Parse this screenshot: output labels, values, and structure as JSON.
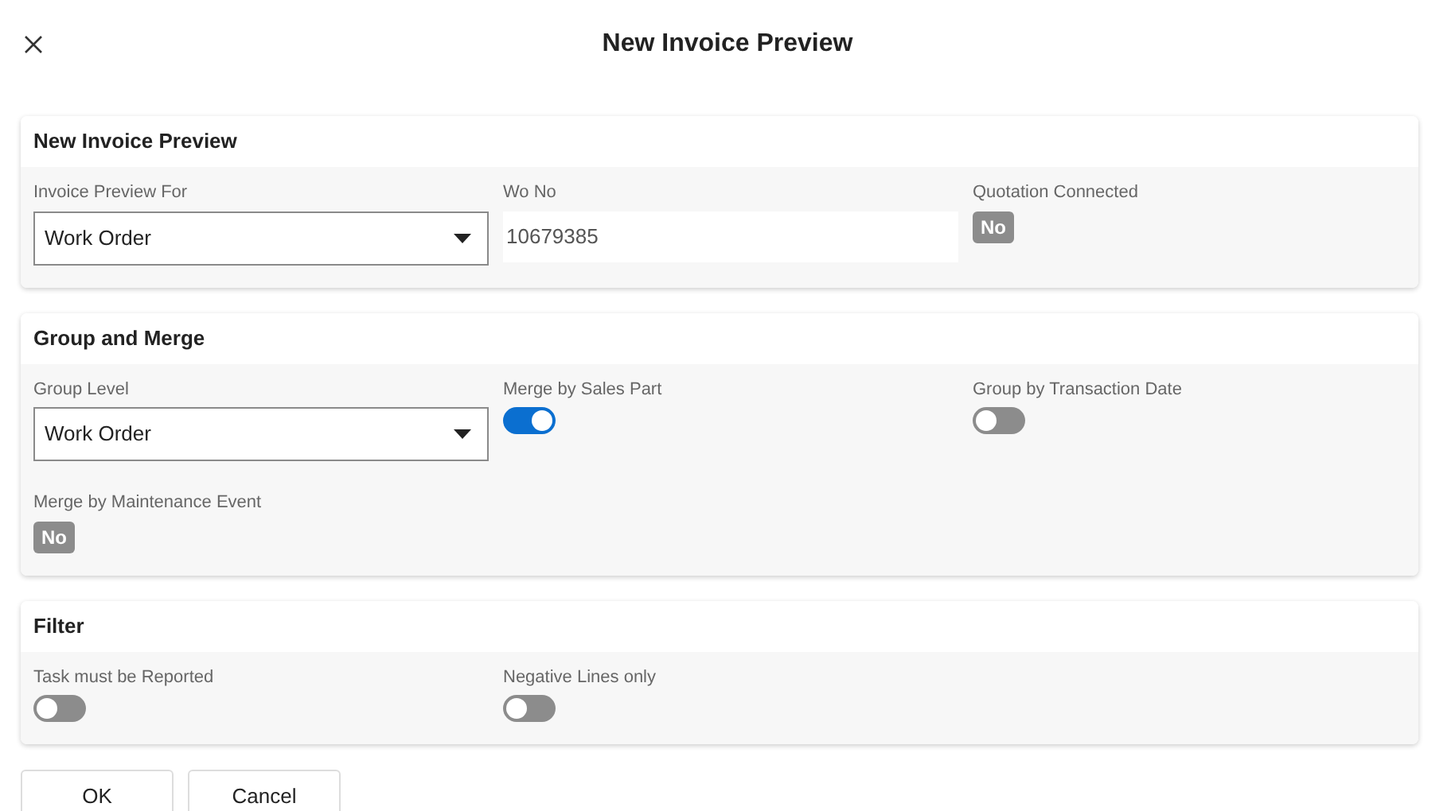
{
  "dialog": {
    "title": "New Invoice Preview"
  },
  "sections": [
    {
      "title": "New Invoice Preview",
      "fields": [
        {
          "kind": "select",
          "label": "Invoice Preview For",
          "value": "Work Order"
        },
        {
          "kind": "text",
          "label": "Wo No",
          "value": "10679385"
        },
        {
          "kind": "badge",
          "label": "Quotation Connected",
          "value": "No"
        }
      ]
    },
    {
      "title": "Group and Merge",
      "fields": [
        {
          "kind": "select",
          "label": "Group Level",
          "value": "Work Order"
        },
        {
          "kind": "toggle",
          "label": "Merge by Sales Part",
          "on": true
        },
        {
          "kind": "toggle",
          "label": "Group by Transaction Date",
          "on": false
        },
        {
          "kind": "badge",
          "label": "Merge by Maintenance Event",
          "value": "No"
        }
      ]
    },
    {
      "title": "Filter",
      "fields": [
        {
          "kind": "toggle",
          "label": "Task must be Reported",
          "on": false
        },
        {
          "kind": "toggle",
          "label": "Negative Lines only",
          "on": false
        }
      ]
    }
  ],
  "buttons": [
    "OK",
    "Cancel"
  ]
}
